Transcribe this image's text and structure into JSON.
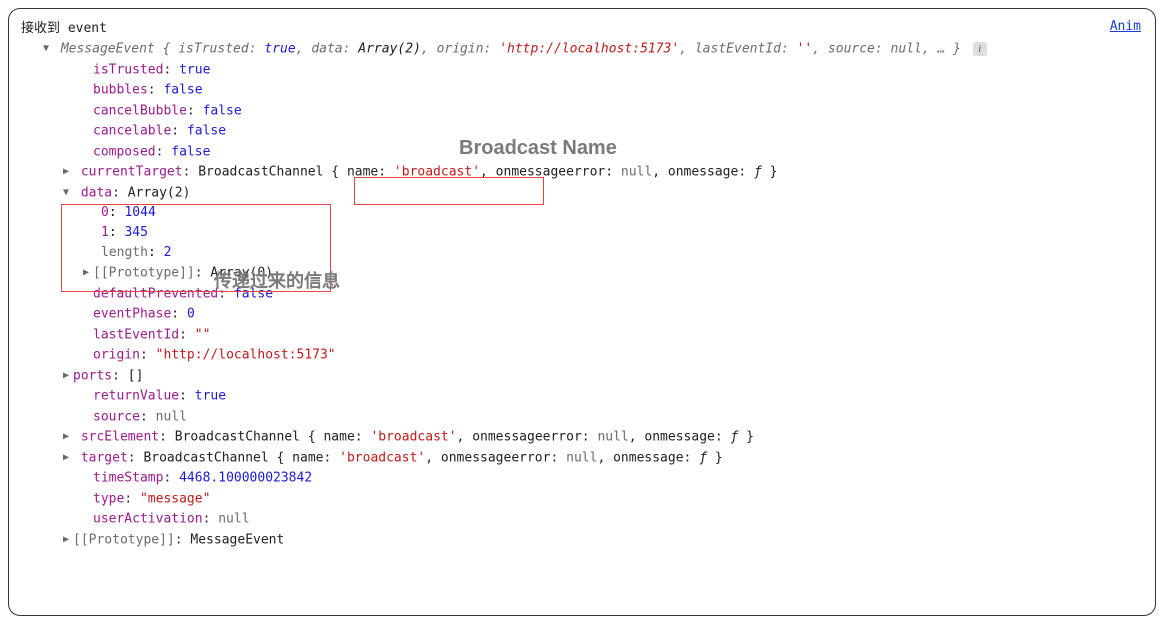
{
  "topLink": "Anim",
  "logTitle": "接收到 event",
  "summaryClass": "MessageEvent",
  "summary": {
    "isTrusted_k": "isTrusted",
    "isTrusted_v": "true",
    "data_k": "data",
    "data_v": "Array(2)",
    "origin_k": "origin",
    "origin_v": "'http://localhost:5173'",
    "lastEventId_k": "lastEventId",
    "lastEventId_v": "''",
    "source_k": "source",
    "source_v": "null",
    "ellipsis": "…"
  },
  "props": {
    "isTrusted_k": "isTrusted",
    "isTrusted_v": "true",
    "bubbles_k": "bubbles",
    "bubbles_v": "false",
    "cancelBubble_k": "cancelBubble",
    "cancelBubble_v": "false",
    "cancelable_k": "cancelable",
    "cancelable_v": "false",
    "composed_k": "composed",
    "composed_v": "false",
    "currentTarget_k": "currentTarget",
    "currentTarget_type": "BroadcastChannel",
    "ct_name_k": "name",
    "ct_name_v": "'broadcast'",
    "ct_onmsgerr_k": "onmessageerror",
    "ct_onmsgerr_v": "null",
    "ct_onmsg_k": "onmessage",
    "ct_onmsg_v": "ƒ",
    "data_k": "data",
    "data_v": "Array(2)",
    "data_0_k": "0",
    "data_0_v": "1044",
    "data_1_k": "1",
    "data_1_v": "345",
    "data_length_k": "length",
    "data_length_v": "2",
    "data_proto_k": "[[Prototype]]",
    "data_proto_v": "Array(0)",
    "defaultPrevented_k": "defaultPrevented",
    "defaultPrevented_v": "false",
    "eventPhase_k": "eventPhase",
    "eventPhase_v": "0",
    "lastEventId_k": "lastEventId",
    "lastEventId_v": "\"\"",
    "origin_k": "origin",
    "origin_v": "\"http://localhost:5173\"",
    "ports_k": "ports",
    "ports_v": "[]",
    "returnValue_k": "returnValue",
    "returnValue_v": "true",
    "source_k": "source",
    "source_v": "null",
    "srcElement_k": "srcElement",
    "srcElement_type": "BroadcastChannel",
    "se_name_k": "name",
    "se_name_v": "'broadcast'",
    "se_onmsgerr_k": "onmessageerror",
    "se_onmsgerr_v": "null",
    "se_onmsg_k": "onmessage",
    "se_onmsg_v": "ƒ",
    "target_k": "target",
    "target_type": "BroadcastChannel",
    "tg_name_k": "name",
    "tg_name_v": "'broadcast'",
    "tg_onmsgerr_k": "onmessageerror",
    "tg_onmsgerr_v": "null",
    "tg_onmsg_k": "onmessage",
    "tg_onmsg_v": "ƒ",
    "timeStamp_k": "timeStamp",
    "timeStamp_v": "4468.100000023842",
    "type_k": "type",
    "type_v": "\"message\"",
    "userActivation_k": "userActivation",
    "userActivation_v": "null",
    "proto_k": "[[Prototype]]",
    "proto_v": "MessageEvent"
  },
  "annotations": {
    "broadcast_name": "Broadcast Name",
    "passed_info": "传递过来的信息"
  }
}
